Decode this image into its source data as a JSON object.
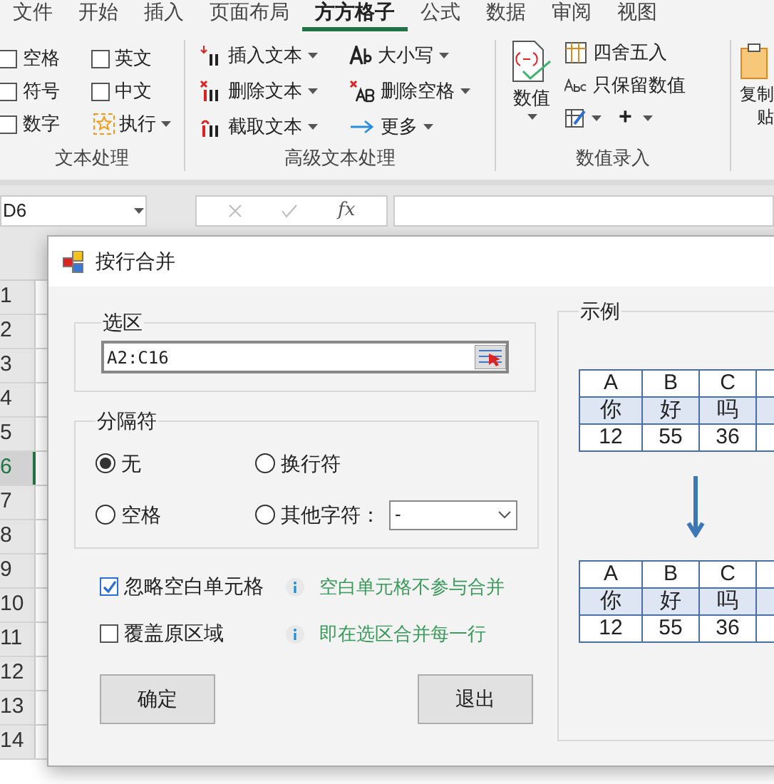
{
  "ribbon": {
    "tabs": [
      {
        "label": "文件",
        "selected": false
      },
      {
        "label": "开始",
        "selected": false
      },
      {
        "label": "插入",
        "selected": false
      },
      {
        "label": "页面布局",
        "selected": false
      },
      {
        "label": "方方格子",
        "selected": true
      },
      {
        "label": "公式",
        "selected": false
      },
      {
        "label": "数据",
        "selected": false
      },
      {
        "label": "审阅",
        "selected": false
      },
      {
        "label": "视图",
        "selected": false
      }
    ],
    "text_group": {
      "label": "文本处理",
      "checkboxes": [
        {
          "label": "空格",
          "checked": false
        },
        {
          "label": "英文",
          "checked": false
        },
        {
          "label": "符号",
          "checked": false
        },
        {
          "label": "中文",
          "checked": false
        },
        {
          "label": "数字",
          "checked": false
        }
      ],
      "run_button": "执行"
    },
    "advanced_group": {
      "label": "高级文本处理",
      "buttons": [
        {
          "label": "插入文本",
          "kind": "insert"
        },
        {
          "label": "删除文本",
          "kind": "delete"
        },
        {
          "label": "截取文本",
          "kind": "cut"
        },
        {
          "label": "大小写",
          "kind": "case"
        },
        {
          "label": "删除空格",
          "kind": "space"
        },
        {
          "label": "更多",
          "kind": "more"
        }
      ]
    },
    "number_group": {
      "label": "数值录入",
      "big_button": "数值",
      "buttons": [
        "四舍五入",
        "只保留数值"
      ],
      "plus_button": "+"
    },
    "clipboard_group": {
      "line_1": "复制",
      "line_2": "贴"
    }
  },
  "formula_bar": {
    "name_box": "D6",
    "function_label": "fx"
  },
  "sheet": {
    "row_headers": [
      {
        "label": "1",
        "selected": false
      },
      {
        "label": "2",
        "selected": false
      },
      {
        "label": "3",
        "selected": false
      },
      {
        "label": "4",
        "selected": false
      },
      {
        "label": "5",
        "selected": false
      },
      {
        "label": "6",
        "selected": true
      },
      {
        "label": "7",
        "selected": false
      },
      {
        "label": "8",
        "selected": false
      },
      {
        "label": "9",
        "selected": false
      },
      {
        "label": "10",
        "selected": false
      },
      {
        "label": "11",
        "selected": false
      },
      {
        "label": "12",
        "selected": false
      },
      {
        "label": "13",
        "selected": false
      },
      {
        "label": "14",
        "selected": false
      }
    ]
  },
  "dialog": {
    "title": "按行合并",
    "selection_group": {
      "legend": "选区",
      "value": "A2:C16"
    },
    "separator_group": {
      "legend": "分隔符",
      "options": [
        {
          "label": "无",
          "selected": true
        },
        {
          "label": "换行符",
          "selected": false
        },
        {
          "label": "空格",
          "selected": false
        },
        {
          "label": "其他字符：",
          "selected": false
        }
      ],
      "other_value": "-"
    },
    "options": [
      {
        "label": "忽略空白单元格",
        "checked": true,
        "hint": "空白单元格不参与合并"
      },
      {
        "label": "覆盖原区域",
        "checked": false,
        "hint": "即在选区合并每一行"
      }
    ],
    "buttons": [
      "确定",
      "退出"
    ],
    "example": {
      "legend": "示例",
      "before": [
        [
          "A",
          "B",
          "C"
        ],
        [
          "你",
          "好",
          "吗"
        ],
        [
          "12",
          "55",
          "36"
        ]
      ],
      "after": [
        [
          "A",
          "B",
          "C"
        ],
        [
          "你",
          "好",
          "吗"
        ],
        [
          "12",
          "55",
          "36"
        ]
      ]
    }
  }
}
